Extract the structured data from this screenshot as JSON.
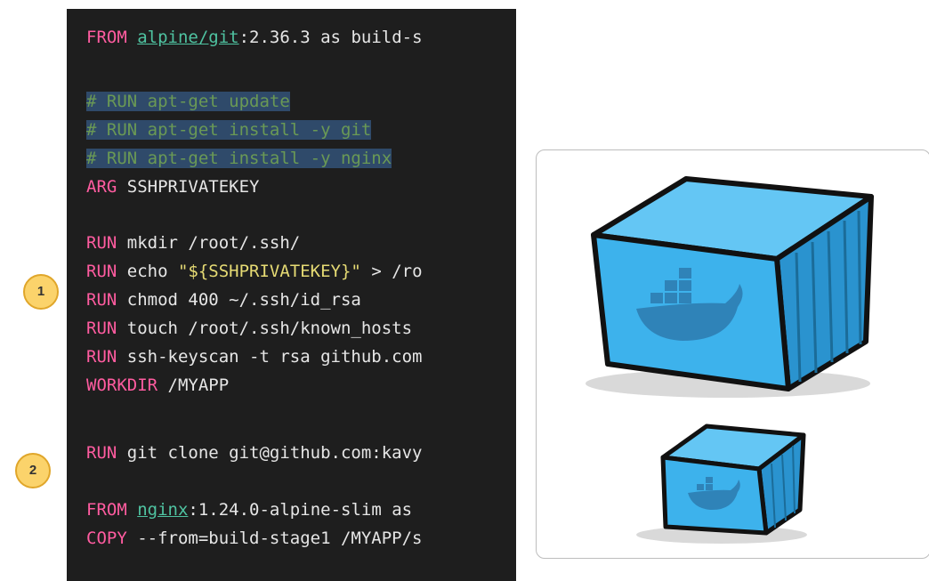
{
  "code": {
    "lines": [
      {
        "segments": [
          {
            "text": "FROM",
            "cls": "kw"
          },
          {
            "text": " ",
            "cls": "txt"
          },
          {
            "text": "alpine/git",
            "cls": "img"
          },
          {
            "text": ":2.36.3 as build-s",
            "cls": "txt"
          }
        ]
      },
      {
        "segments": [
          {
            "text": "# RUN apt-get update",
            "cls": "comment"
          }
        ]
      },
      {
        "segments": [
          {
            "text": "# RUN apt-get install -y git",
            "cls": "comment"
          }
        ]
      },
      {
        "segments": [
          {
            "text": "# RUN apt-get install -y nginx",
            "cls": "comment"
          }
        ]
      },
      {
        "segments": [
          {
            "text": "ARG",
            "cls": "kw"
          },
          {
            "text": " SSHPRIVATEKEY",
            "cls": "txt"
          }
        ]
      },
      {
        "segments": [
          {
            "text": "RUN",
            "cls": "kw"
          },
          {
            "text": " mkdir /root/.ssh/",
            "cls": "txt"
          }
        ]
      },
      {
        "segments": [
          {
            "text": "RUN",
            "cls": "kw"
          },
          {
            "text": " echo ",
            "cls": "txt"
          },
          {
            "text": "\"${SSHPRIVATEKEY}\"",
            "cls": "str"
          },
          {
            "text": " > /ro",
            "cls": "txt"
          }
        ]
      },
      {
        "segments": [
          {
            "text": "RUN",
            "cls": "kw"
          },
          {
            "text": " chmod 400 ~/.ssh/id_rsa",
            "cls": "txt"
          }
        ]
      },
      {
        "segments": [
          {
            "text": "RUN",
            "cls": "kw"
          },
          {
            "text": " touch /root/.ssh/known_hosts",
            "cls": "txt"
          }
        ]
      },
      {
        "segments": [
          {
            "text": "RUN",
            "cls": "kw"
          },
          {
            "text": " ssh-keyscan -t rsa github.com",
            "cls": "txt"
          }
        ]
      },
      {
        "segments": [
          {
            "text": "WORKDIR",
            "cls": "kw"
          },
          {
            "text": " /MYAPP",
            "cls": "txt"
          }
        ]
      },
      {
        "segments": [
          {
            "text": "RUN",
            "cls": "kw"
          },
          {
            "text": " git clone git@github.com:kavy",
            "cls": "txt"
          }
        ]
      },
      {
        "segments": [
          {
            "text": "FROM",
            "cls": "kw"
          },
          {
            "text": " ",
            "cls": "txt"
          },
          {
            "text": "nginx",
            "cls": "img"
          },
          {
            "text": ":1.24.0-alpine-slim as",
            "cls": "txt"
          }
        ]
      },
      {
        "segments": [
          {
            "text": "COPY",
            "cls": "kw"
          },
          {
            "text": " --from=build-stage1 /MYAPP/s",
            "cls": "txt"
          }
        ]
      }
    ]
  },
  "badges": [
    {
      "label": "1"
    },
    {
      "label": "2"
    }
  ],
  "illustration": {
    "icon": "docker-container-icon",
    "colors": {
      "box": "#3daee9",
      "outline": "#111111",
      "shadow": "#d6d6d6"
    }
  }
}
